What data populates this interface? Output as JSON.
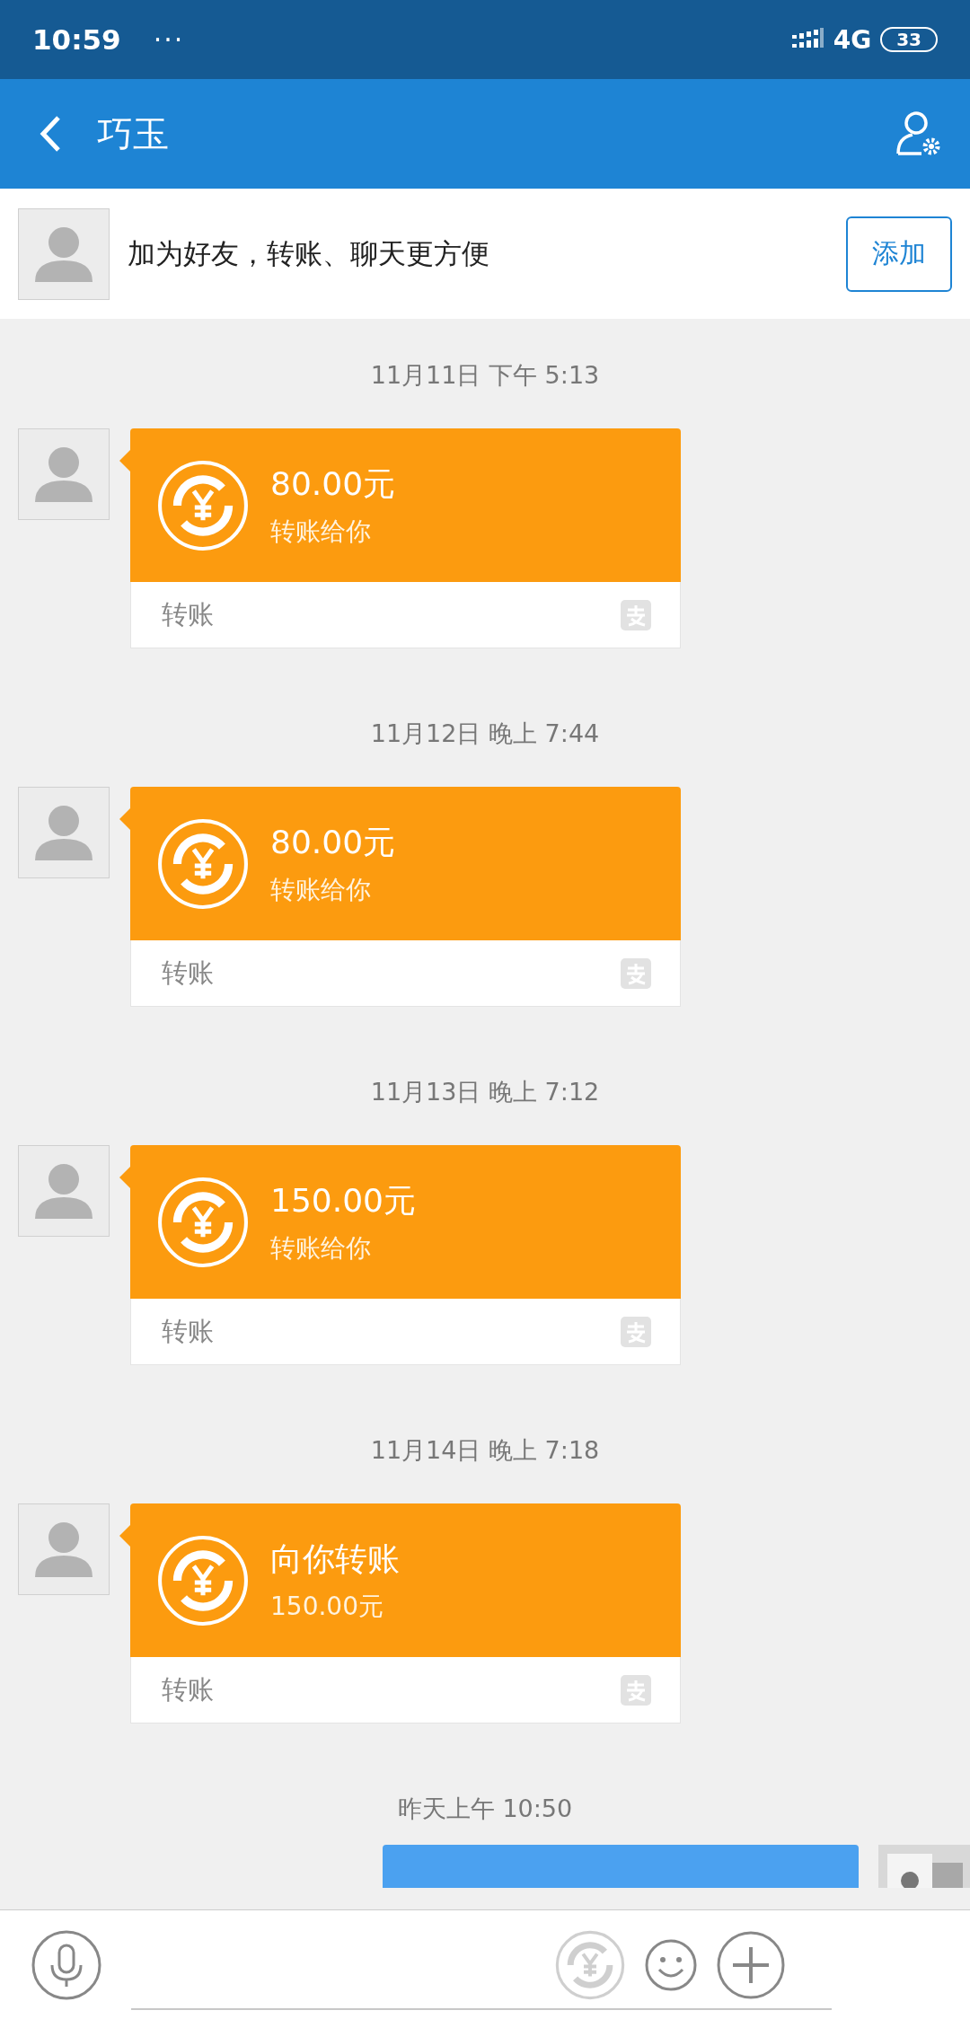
{
  "status_bar": {
    "time": "10:59",
    "dots": "···",
    "network": "4G",
    "battery": "33"
  },
  "header": {
    "title": "巧玉"
  },
  "friend_banner": {
    "text": "加为好友，转账、聊天更方便",
    "button": "添加"
  },
  "messages": [
    {
      "kind": "transfer",
      "timestamp": "11月11日 下午 5:13",
      "title": "80.00元",
      "subtitle": "转账给你",
      "footer": "转账"
    },
    {
      "kind": "transfer",
      "timestamp": "11月12日 晚上 7:44",
      "title": "80.00元",
      "subtitle": "转账给你",
      "footer": "转账"
    },
    {
      "kind": "transfer",
      "timestamp": "11月13日 晚上 7:12",
      "title": "150.00元",
      "subtitle": "转账给你",
      "footer": "转账"
    },
    {
      "kind": "transfer",
      "timestamp": "11月14日 晚上 7:18",
      "title": "向你转账",
      "subtitle": "150.00元",
      "footer": "转账"
    },
    {
      "kind": "outgoing",
      "timestamp": "昨天上午 10:50"
    }
  ]
}
